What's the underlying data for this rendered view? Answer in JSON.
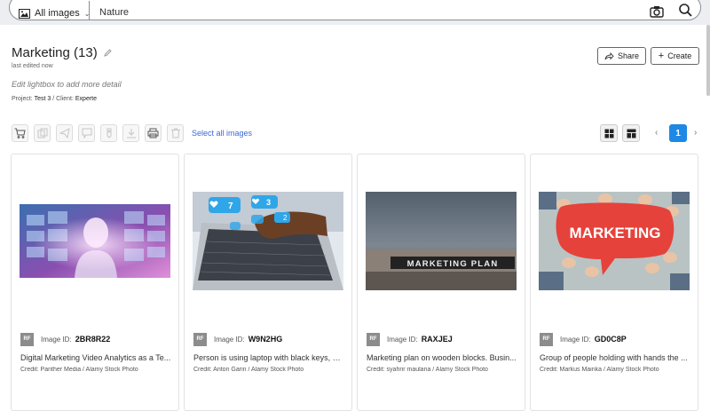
{
  "search": {
    "scope_label": "All images",
    "query": "Nature"
  },
  "lightbox": {
    "title": "Marketing (13)",
    "edited": "last edited now",
    "hint": "Edit lightbox to add more detail",
    "project_label": "Project:",
    "project": "Test 3",
    "client_label": "/ Client:",
    "client": "Experte"
  },
  "actions": {
    "share_label": "Share",
    "create_label": "Create"
  },
  "toolbar": {
    "select_all_label": "Select all images",
    "tools": [
      "cart-icon",
      "copy-icon",
      "share-icon",
      "comment-icon",
      "tag-icon",
      "download-icon",
      "print-icon",
      "trash-icon"
    ]
  },
  "pagination": {
    "current": "1"
  },
  "cards": [
    {
      "license": "RF",
      "id_label": "Image ID:",
      "id": "2BR8R22",
      "caption": "Digital Marketing Video Analytics as a Te...",
      "credit": "Credit: Panther Media / Alamy Stock Photo"
    },
    {
      "license": "RF",
      "id_label": "Image ID:",
      "id": "W9N2HG",
      "caption": "Person is using laptop with black keys, S...",
      "credit": "Credit: Anton Garin / Alamy Stock Photo"
    },
    {
      "license": "RF",
      "id_label": "Image ID:",
      "id": "RAXJEJ",
      "caption": "Marketing plan on wooden blocks. Busin...",
      "credit": "Credit: syahrir maulana / Alamy Stock Photo"
    },
    {
      "license": "RF",
      "id_label": "Image ID:",
      "id": "GD0C8P",
      "caption": "Group of people holding with hands the ...",
      "credit": "Credit: Markus Mainka / Alamy Stock Photo"
    }
  ],
  "thumb_text": {
    "likes": "7",
    "likes2": "3",
    "comments": "2",
    "blocks": "MARKETING PLAN",
    "bubble": "MARKETING"
  },
  "colors": {
    "accent": "#1e88e5",
    "link": "#3b6ad8"
  }
}
